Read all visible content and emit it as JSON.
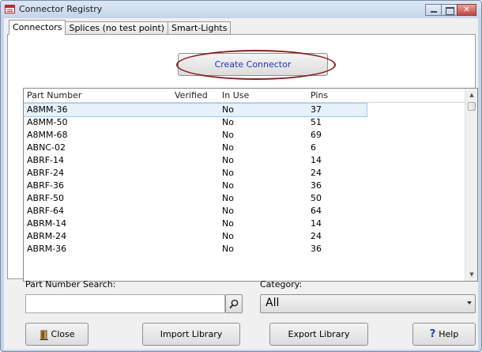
{
  "window": {
    "title": "Connector Registry"
  },
  "tabs": [
    {
      "label": "Connectors",
      "active": true
    },
    {
      "label": "Splices (no test point)",
      "active": false
    },
    {
      "label": "Smart-Lights",
      "active": false
    }
  ],
  "create_button": {
    "label": "Create Connector"
  },
  "table": {
    "columns": [
      "Part Number",
      "Verified",
      "In Use",
      "Pins"
    ],
    "rows": [
      {
        "part": "A8MM-36",
        "verified": "",
        "in_use": "No",
        "pins": "37",
        "selected": true
      },
      {
        "part": "A8MM-50",
        "verified": "",
        "in_use": "No",
        "pins": "51"
      },
      {
        "part": "A8MM-68",
        "verified": "",
        "in_use": "No",
        "pins": "69"
      },
      {
        "part": "ABNC-02",
        "verified": "",
        "in_use": "No",
        "pins": "6"
      },
      {
        "part": "ABRF-14",
        "verified": "",
        "in_use": "No",
        "pins": "14"
      },
      {
        "part": "ABRF-24",
        "verified": "",
        "in_use": "No",
        "pins": "24"
      },
      {
        "part": "ABRF-36",
        "verified": "",
        "in_use": "No",
        "pins": "36"
      },
      {
        "part": "ABRF-50",
        "verified": "",
        "in_use": "No",
        "pins": "50"
      },
      {
        "part": "ABRF-64",
        "verified": "",
        "in_use": "No",
        "pins": "64"
      },
      {
        "part": "ABRM-14",
        "verified": "",
        "in_use": "No",
        "pins": "14"
      },
      {
        "part": "ABRM-24",
        "verified": "",
        "in_use": "No",
        "pins": "24"
      },
      {
        "part": "ABRM-36",
        "verified": "",
        "in_use": "No",
        "pins": "36"
      }
    ]
  },
  "search": {
    "label": "Part Number Search:",
    "value": ""
  },
  "category": {
    "label": "Category:",
    "value": "All"
  },
  "buttons": {
    "close": "Close",
    "import": "Import Library",
    "export": "Export Library",
    "help": "Help"
  },
  "colors": {
    "highlight_ring": "#8b1e1e",
    "link_text": "#1c2ecb",
    "selection": "#e5f1fb"
  },
  "icons": [
    "app-icon",
    "search-icon",
    "close-door-icon",
    "help-icon"
  ]
}
